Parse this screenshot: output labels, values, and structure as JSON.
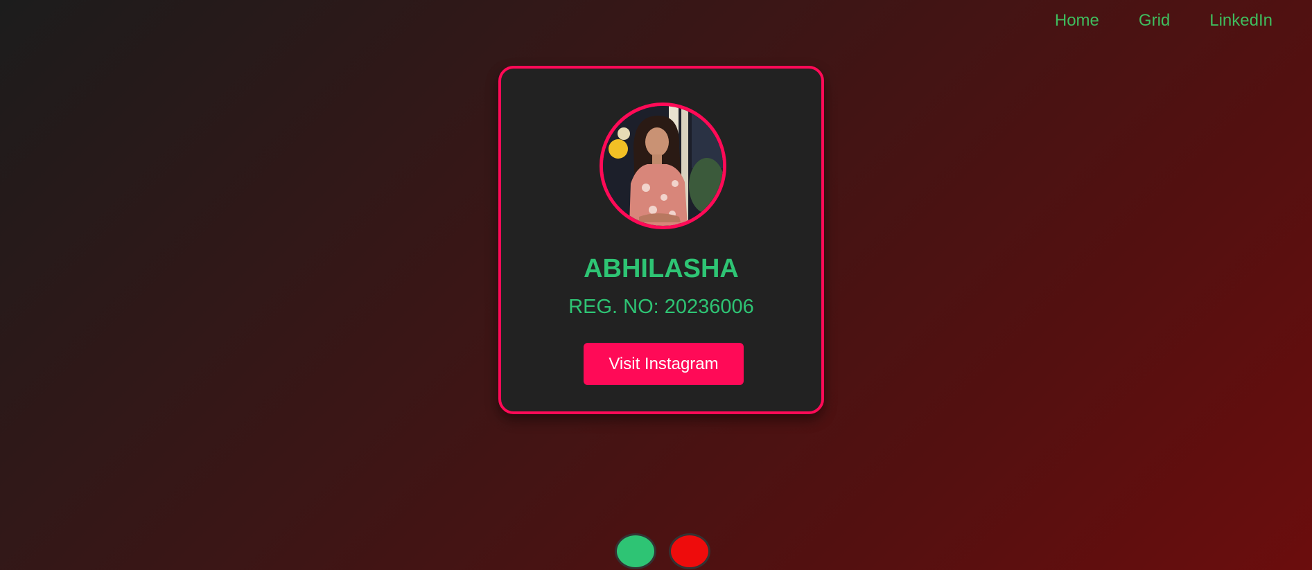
{
  "nav": {
    "items": [
      {
        "label": "Home"
      },
      {
        "label": "Grid"
      },
      {
        "label": "LinkedIn"
      }
    ]
  },
  "profile": {
    "name": "ABHILASHA",
    "reg": "REG. NO: 20236006",
    "button_label": "Visit Instagram"
  },
  "theme_dots": [
    {
      "name": "green",
      "color": "#2ec474"
    },
    {
      "name": "red",
      "color": "#ee0c0c"
    }
  ],
  "colors": {
    "accent": "#ff0a57",
    "text_green": "#2ec474",
    "nav_green": "#3fbd5e",
    "card_bg": "#222222"
  }
}
